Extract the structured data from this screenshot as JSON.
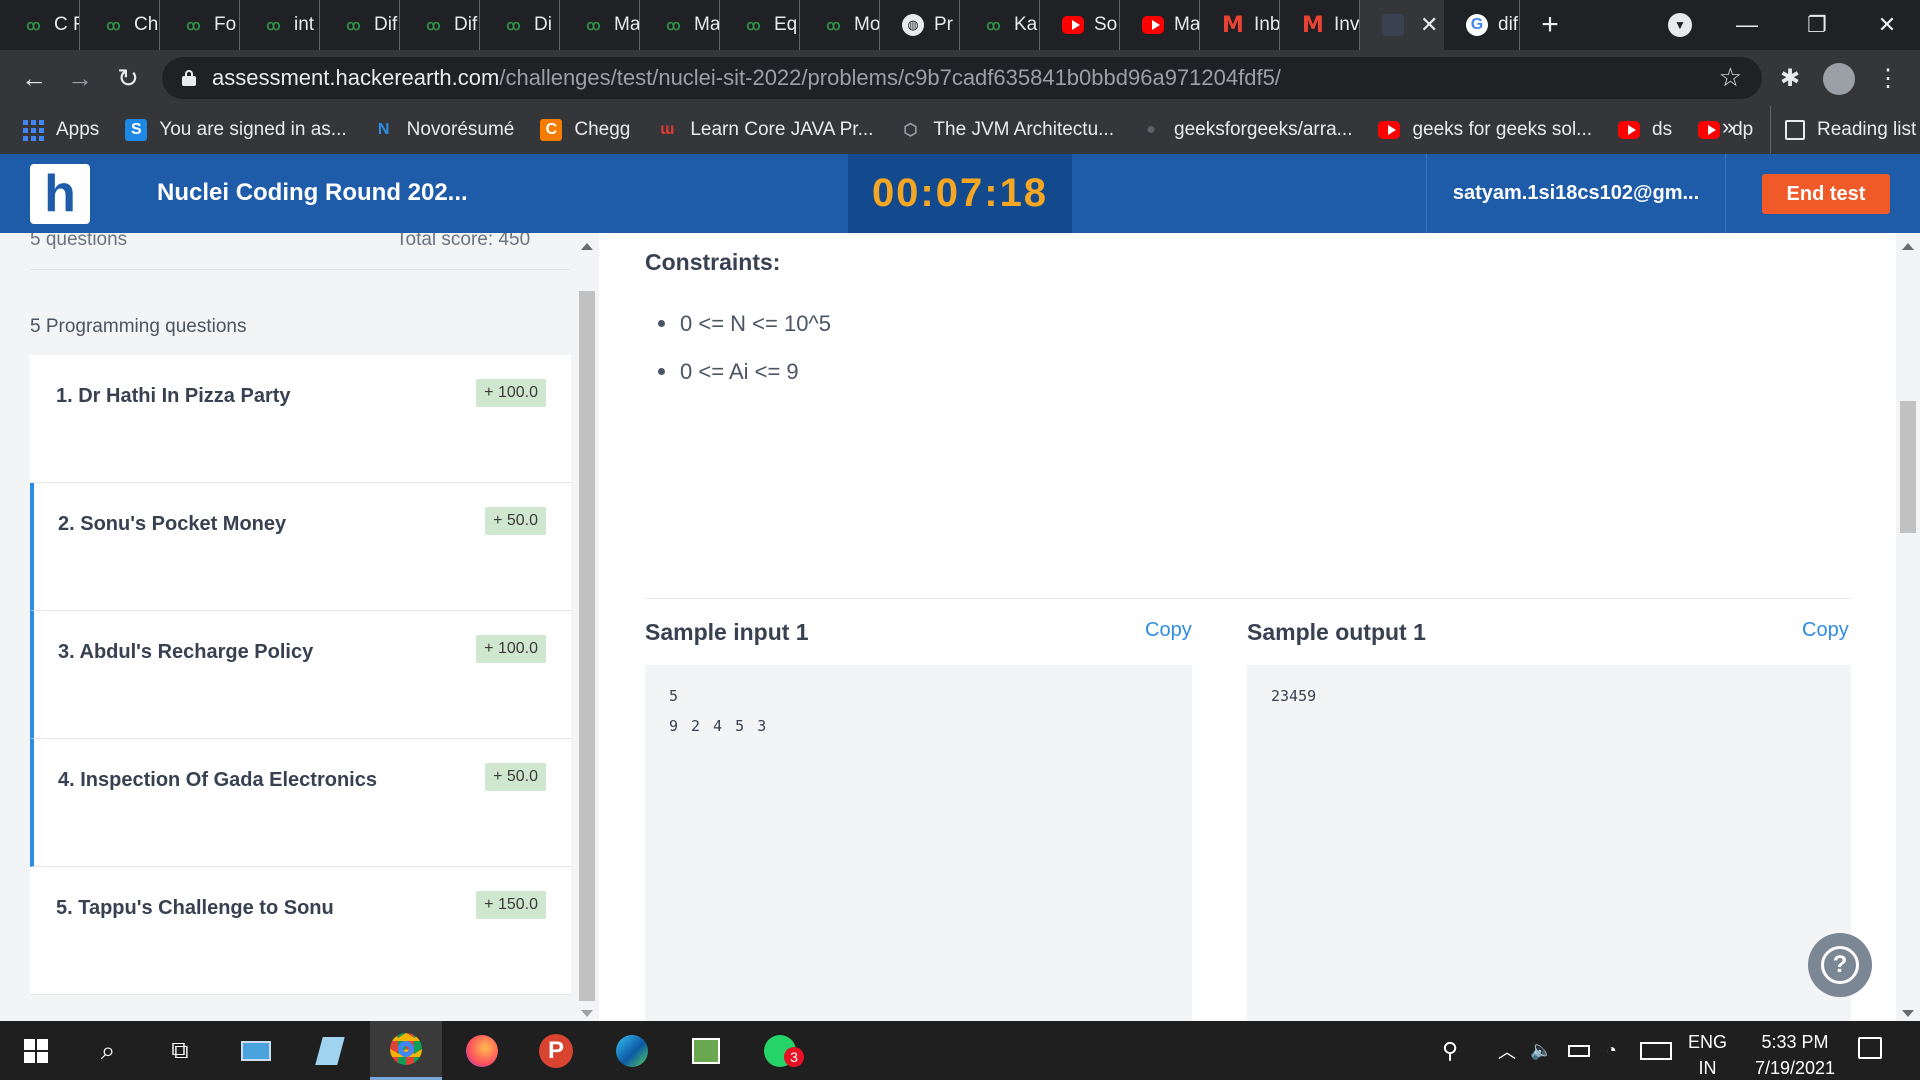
{
  "browser": {
    "tabs": [
      {
        "icon": "gfg-icon",
        "label": "C F"
      },
      {
        "icon": "gfg-icon",
        "label": "Ch"
      },
      {
        "icon": "gfg-icon",
        "label": "Fo"
      },
      {
        "icon": "gfg-icon",
        "label": "int"
      },
      {
        "icon": "gfg-icon",
        "label": "Dif"
      },
      {
        "icon": "gfg-icon",
        "label": "Dif"
      },
      {
        "icon": "gfg-icon",
        "label": "Di"
      },
      {
        "icon": "gfg-icon",
        "label": "Ma"
      },
      {
        "icon": "gfg-icon",
        "label": "Ma"
      },
      {
        "icon": "gfg-icon",
        "label": "Eq"
      },
      {
        "icon": "gfg-icon",
        "label": "Mo"
      },
      {
        "icon": "globe-icon",
        "label": "Pr"
      },
      {
        "icon": "gfg-icon",
        "label": "Ka"
      },
      {
        "icon": "youtube-icon",
        "label": "So"
      },
      {
        "icon": "youtube-icon",
        "label": "Ma"
      },
      {
        "icon": "gmail-icon",
        "label": "Inb"
      },
      {
        "icon": "gmail-icon",
        "label": "Inv"
      }
    ],
    "active_tab_close": "✕",
    "google_tab_label": "dif",
    "new_tab": "+",
    "url_host": "assessment.hackerearth.com",
    "url_path": "/challenges/test/nuclei-sit-2022/problems/c9b7cadf635841b0bbd96a971204fdf5/",
    "bookmarks": [
      {
        "icon": "apps-icon",
        "label": "Apps"
      },
      {
        "icon": "s-icon",
        "label": "You are signed in as..."
      },
      {
        "icon": "novoresume-icon",
        "label": "Novorésumé"
      },
      {
        "icon": "chegg-icon",
        "label": "Chegg"
      },
      {
        "icon": "learn-icon",
        "label": "Learn Core JAVA Pr..."
      },
      {
        "icon": "jvm-icon",
        "label": "The JVM Architectu..."
      },
      {
        "icon": "github-icon",
        "label": "geeksforgeeks/arra..."
      },
      {
        "icon": "youtube-icon",
        "label": "geeks for geeks sol..."
      },
      {
        "icon": "youtube-icon",
        "label": "ds"
      },
      {
        "icon": "youtube-icon",
        "label": "dp"
      }
    ],
    "bookmarks_more": "»",
    "reading_list": "Reading list"
  },
  "header": {
    "logo_letter": "h",
    "title": "Nuclei Coding Round 202...",
    "timer": "00:07:18",
    "email": "satyam.1si18cs102@gm...",
    "end_test": "End test"
  },
  "sidebar": {
    "question_count": "5 questions",
    "total_score": "Total score: 450",
    "section_label": "5 Programming questions",
    "questions": [
      {
        "title": "1.  Dr Hathi In Pizza Party",
        "score": "+ 100.0",
        "visited": false
      },
      {
        "title": "2.  Sonu's Pocket Money",
        "score": "+ 50.0",
        "visited": true
      },
      {
        "title": "3.  Abdul's Recharge Policy",
        "score": "+ 100.0",
        "visited": true
      },
      {
        "title": "4.  Inspection Of Gada Electronics",
        "score": "+ 50.0",
        "visited": true
      },
      {
        "title": "5.  Tappu's Challenge to Sonu",
        "score": "+ 150.0",
        "visited": false
      }
    ]
  },
  "problem": {
    "constraints_heading": "Constraints:",
    "constraints": [
      "0 <= N <= 10^5",
      "0 <= Ai <= 9"
    ],
    "sample_input_heading": "Sample input 1",
    "sample_output_heading": "Sample output 1",
    "copy_label": "Copy",
    "sample_input_lines": [
      "5",
      "9 2 4 5 3"
    ],
    "sample_output_lines": [
      "23459"
    ],
    "help_label": "?"
  },
  "taskbar": {
    "whatsapp_badge": "3",
    "lang_top": "ENG",
    "lang_bottom": "IN",
    "time": "5:33 PM",
    "date": "7/19/2021"
  }
}
